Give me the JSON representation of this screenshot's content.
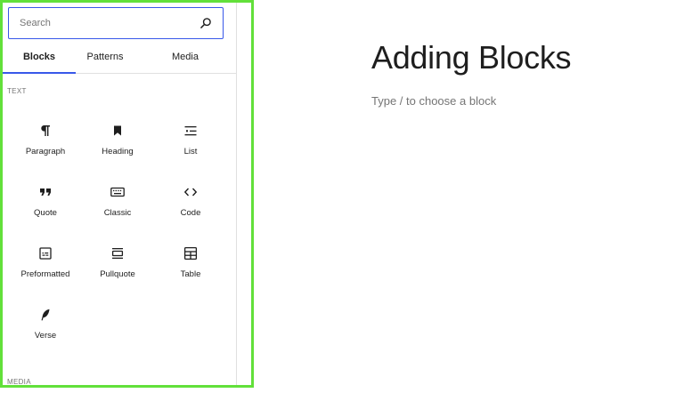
{
  "inserter": {
    "search": {
      "placeholder": "Search",
      "value": ""
    },
    "tabs": [
      {
        "label": "Blocks",
        "active": true
      },
      {
        "label": "Patterns",
        "active": false
      },
      {
        "label": "Media",
        "active": false
      }
    ],
    "sections": [
      {
        "label": "TEXT",
        "blocks": [
          {
            "label": "Paragraph",
            "icon": "paragraph-icon"
          },
          {
            "label": "Heading",
            "icon": "heading-bookmark-icon"
          },
          {
            "label": "List",
            "icon": "list-icon"
          },
          {
            "label": "Quote",
            "icon": "quote-icon"
          },
          {
            "label": "Classic",
            "icon": "keyboard-icon"
          },
          {
            "label": "Code",
            "icon": "code-icon"
          },
          {
            "label": "Preformatted",
            "icon": "preformatted-icon"
          },
          {
            "label": "Pullquote",
            "icon": "pullquote-icon"
          },
          {
            "label": "Table",
            "icon": "table-icon"
          },
          {
            "label": "Verse",
            "icon": "quill-icon"
          }
        ]
      },
      {
        "label": "MEDIA",
        "blocks": []
      }
    ],
    "highlight_color": "#62e03a",
    "accent_color": "#3858e9"
  },
  "editor": {
    "title": "Adding Blocks",
    "placeholder": "Type / to choose a block"
  }
}
